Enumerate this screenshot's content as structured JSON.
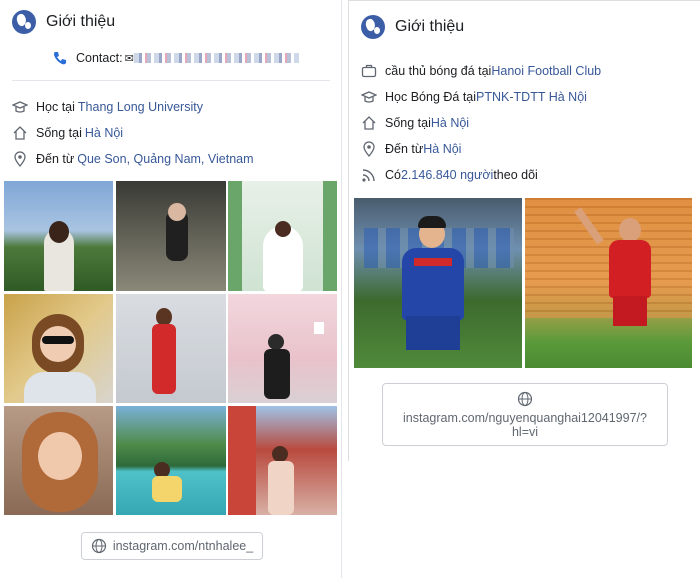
{
  "left": {
    "title": "Giới thiệu",
    "contact_label": "Contact:",
    "rows": [
      {
        "icon": "graduation-cap-icon",
        "prefix": "Học tại ",
        "link": "Thang Long University"
      },
      {
        "icon": "home-icon",
        "prefix": "Sống tại ",
        "link": "Hà Nội"
      },
      {
        "icon": "location-pin-icon",
        "prefix": "Đến từ ",
        "link": "Que Son, Quảng Nam, Vietnam"
      }
    ],
    "website": "instagram.com/ntnhalee_"
  },
  "right": {
    "title": "Giới thiệu",
    "rows": [
      {
        "icon": "briefcase-icon",
        "prefix": "cầu thủ bóng đá tại ",
        "link": "Hanoi Football Club",
        "suffix": ""
      },
      {
        "icon": "graduation-cap-icon",
        "prefix": "Học Bóng Đá tại ",
        "link": "PTNK-TDTT Hà Nội",
        "suffix": ""
      },
      {
        "icon": "home-icon",
        "prefix": "Sống tại ",
        "link": "Hà Nội",
        "suffix": ""
      },
      {
        "icon": "location-pin-icon",
        "prefix": "Đến từ ",
        "link": "Hà Nội",
        "suffix": ""
      },
      {
        "icon": "rss-followers-icon",
        "prefix": "Có ",
        "link": "2.146.840 người",
        "suffix": " theo dõi"
      }
    ],
    "website_line1": "instagram.com/nguyenquanghai12041997/?",
    "website_line2": "hl=vi"
  },
  "colors": {
    "link": "#385898",
    "globe": "#3b5ea7",
    "border": "#ccd0d5"
  }
}
